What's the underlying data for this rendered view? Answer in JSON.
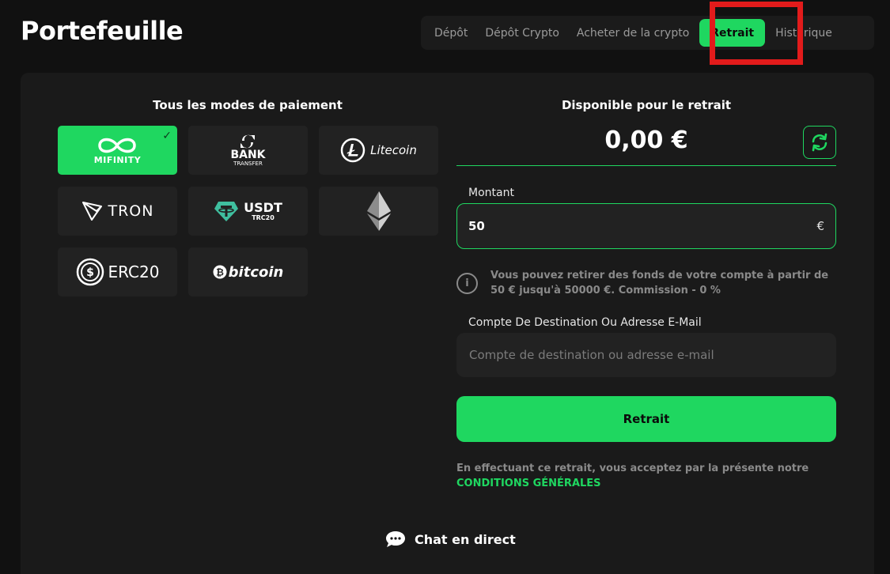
{
  "header": {
    "title": "Portefeuille",
    "tabs": [
      {
        "label": "Dépôt"
      },
      {
        "label": "Dépôt Crypto"
      },
      {
        "label": "Acheter de la crypto"
      },
      {
        "label": "Retrait"
      },
      {
        "label": "Historique"
      }
    ],
    "active_tab": "Retrait"
  },
  "payment_methods": {
    "title": "Tous les modes de paiement",
    "items": [
      {
        "name": "MIFINITY",
        "icon": "mifinity-logo",
        "selected": true
      },
      {
        "name": "BANK",
        "sub": "TRANSFER",
        "icon": "bank-transfer-logo"
      },
      {
        "name": "Litecoin",
        "icon": "litecoin-logo"
      },
      {
        "name": "TRON",
        "icon": "tron-logo"
      },
      {
        "name": "USDT",
        "sub": "TRC20",
        "icon": "usdt-trc20-logo"
      },
      {
        "name": "",
        "icon": "ethereum-logo"
      },
      {
        "name": "ERC20",
        "icon": "erc20-logo"
      },
      {
        "name": "bitcoin",
        "icon": "bitcoin-logo"
      }
    ]
  },
  "withdraw": {
    "available_title": "Disponible pour le retrait",
    "balance": "0,00 €",
    "amount_label": "Montant",
    "amount_value": "50",
    "currency": "€",
    "info_text": "Vous pouvez retirer des fonds de votre compte à partir de 50 € jusqu'à 50000 €. Commission - 0 %",
    "destination_label": "Compte De Destination Ou Adresse E-Mail",
    "destination_placeholder": "Compte de destination ou adresse e-mail",
    "submit_label": "Retrait",
    "terms_text": "En effectuant ce retrait, vous acceptez par la présente notre",
    "terms_link": "CONDITIONS GÉNÉRALES"
  },
  "chat": {
    "label": "Chat en direct"
  },
  "colors": {
    "accent": "#1fd760",
    "background": "#111111",
    "panel": "#1a1a1a",
    "card": "#222222",
    "highlight": "#e21b1b"
  }
}
